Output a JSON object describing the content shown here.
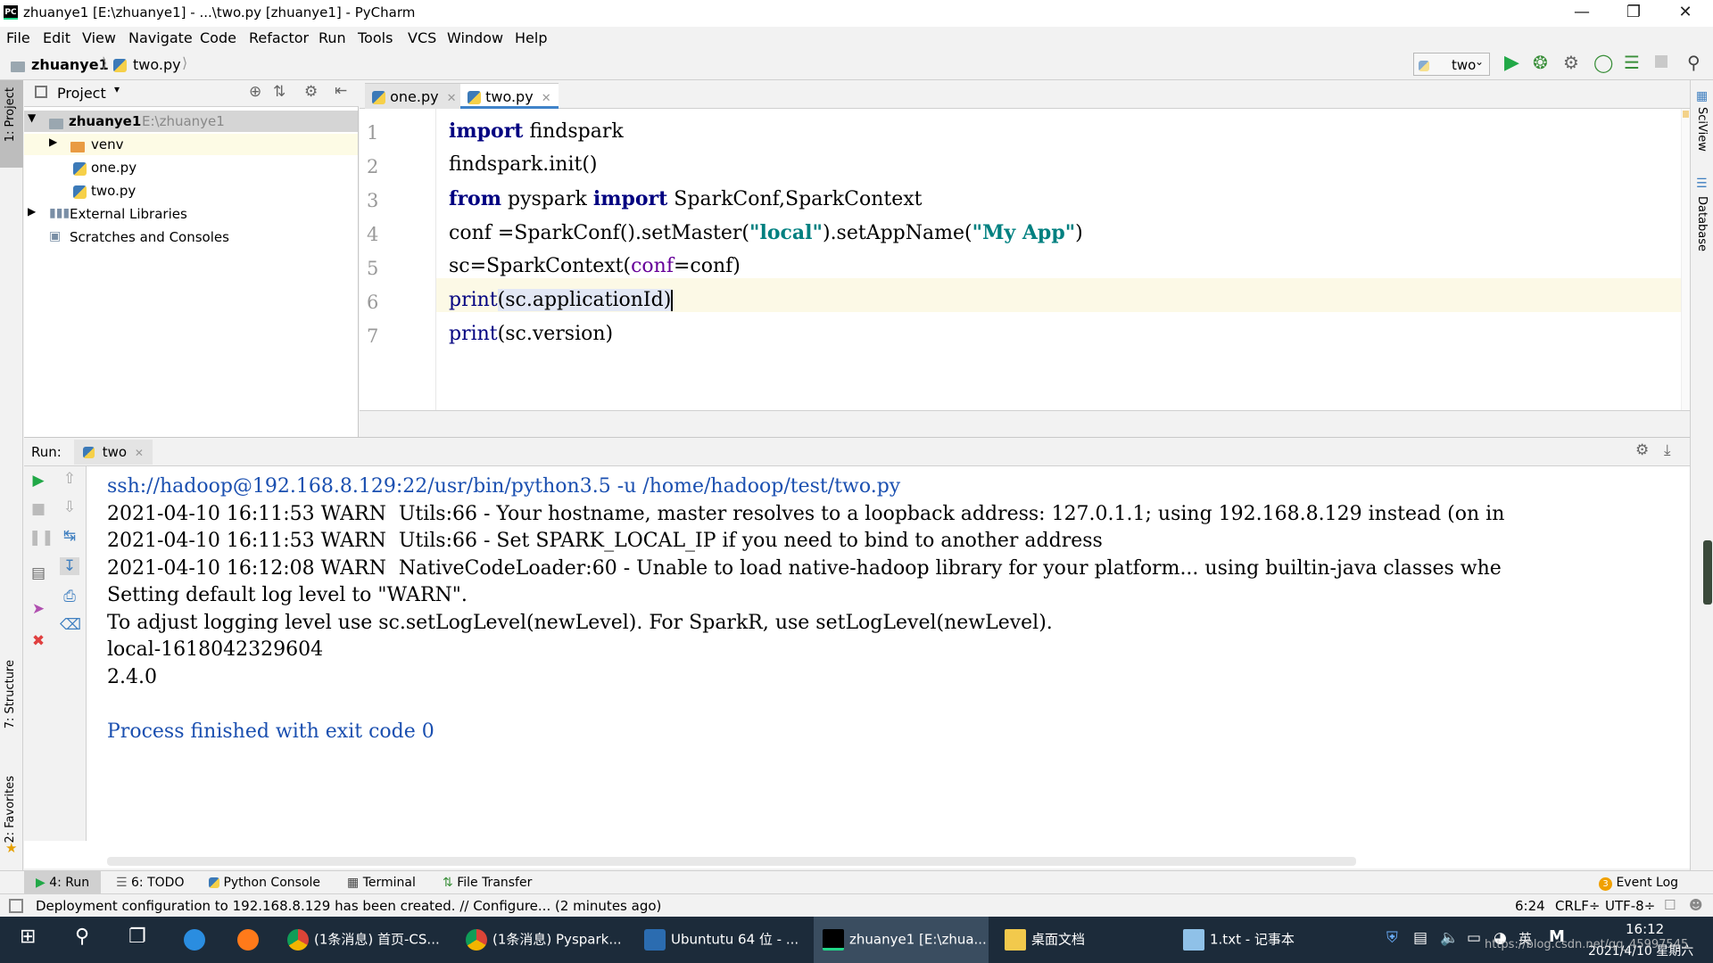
{
  "window": {
    "title": "zhuanye1 [E:\\zhuanye1] - ...\\two.py [zhuanye1] - PyCharm",
    "app_icon_label": "PC"
  },
  "menu": [
    "File",
    "Edit",
    "View",
    "Navigate",
    "Code",
    "Refactor",
    "Run",
    "Tools",
    "VCS",
    "Window",
    "Help"
  ],
  "navbar": {
    "crumbs": [
      "zhuanye1",
      "two.py"
    ],
    "run_config": "two"
  },
  "left_strip": {
    "top": "1: Project",
    "mid": "7: Structure",
    "bottom": "2: Favorites"
  },
  "right_strip": {
    "top": "SciView",
    "bottom": "Database"
  },
  "project": {
    "header": "Project",
    "root_name": "zhuanye1",
    "root_path": "E:\\zhuanye1",
    "items": [
      "venv",
      "one.py",
      "two.py"
    ],
    "external": "External Libraries",
    "scratches": "Scratches and Consoles"
  },
  "editor": {
    "tabs": [
      "one.py",
      "two.py"
    ],
    "line_numbers": [
      "1",
      "2",
      "3",
      "4",
      "5",
      "6",
      "7"
    ],
    "lines": {
      "l1_kw": "import",
      "l1_rest": " findspark",
      "l2": "findspark.init()",
      "l3_kw1": "from",
      "l3_mid": " pyspark ",
      "l3_kw2": "import",
      "l3_rest": " SparkConf,SparkContext",
      "l4_a": "conf =SparkConf().setMaster(",
      "l4_s1": "\"local\"",
      "l4_b": ").setAppName(",
      "l4_s2": "\"My App\"",
      "l4_c": ")",
      "l5_a": "sc=SparkContext(",
      "l5_param": "conf",
      "l5_b": "=conf)",
      "l6_fn": "print",
      "l6_rest": "(sc.applicationId)",
      "l7_fn": "print",
      "l7_rest": "(sc.version)"
    }
  },
  "run": {
    "label": "Run:",
    "tab": "two",
    "output": [
      "ssh://hadoop@192.168.8.129:22/usr/bin/python3.5 -u /home/hadoop/test/two.py",
      "2021-04-10 16:11:53 WARN  Utils:66 - Your hostname, master resolves to a loopback address: 127.0.1.1; using 192.168.8.129 instead (on in",
      "2021-04-10 16:11:53 WARN  Utils:66 - Set SPARK_LOCAL_IP if you need to bind to another address",
      "2021-04-10 16:12:08 WARN  NativeCodeLoader:60 - Unable to load native-hadoop library for your platform... using builtin-java classes whe",
      "Setting default log level to \"WARN\".",
      "To adjust logging level use sc.setLogLevel(newLevel). For SparkR, use setLogLevel(newLevel).",
      "local-1618042329604",
      "2.4.0",
      "Process finished with exit code 0"
    ]
  },
  "bottom_tabs": [
    "4: Run",
    "6: TODO",
    "Python Console",
    "Terminal",
    "File Transfer"
  ],
  "event_log": "Event Log",
  "event_count": "3",
  "status": {
    "message": "Deployment configuration to 192.168.8.129 has been created. // Configure... (2 minutes ago)",
    "position": "6:24",
    "line_sep": "CRLF÷",
    "encoding": "UTF-8÷"
  },
  "taskbar": {
    "items": [
      "(1条消息) 首页-CS...",
      "(1条消息) Pyspark...",
      "Ubuntutu 64 位 - ...",
      "zhuanye1 [E:\\zhua...",
      "桌面文档",
      "1.txt - 记事本"
    ],
    "ime": "英",
    "time": "16:12",
    "date": "2021/4/10 星期六",
    "watermark": "https://blog.csdn.net/qq_45997545"
  }
}
